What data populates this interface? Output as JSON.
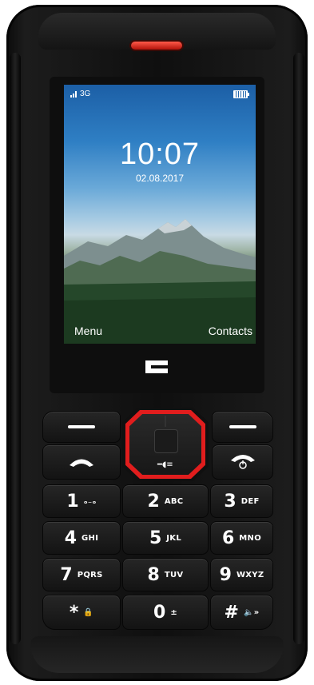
{
  "status_bar": {
    "signal_icon": "signal-bars-icon",
    "network": "3G",
    "battery_icon": "battery-full-icon"
  },
  "home": {
    "time": "10:07",
    "date": "02.08.2017",
    "wallpaper": "mountain-forest-landscape"
  },
  "softkeys": {
    "left": "Menu",
    "right": "Contacts"
  },
  "brand_logo": "crosscall-logo",
  "keypad": {
    "left_softkey_icon": "dash-icon",
    "right_softkey_icon": "dash-icon",
    "call_icon": "phone-call-icon",
    "end_icon": "phone-end-power-icon",
    "nav_center_icon": "torch-icon",
    "keys": [
      {
        "num": "1",
        "letters": "ₒ₋ₒ"
      },
      {
        "num": "2",
        "letters": "ABC"
      },
      {
        "num": "3",
        "letters": "DEF"
      },
      {
        "num": "4",
        "letters": "GHI"
      },
      {
        "num": "5",
        "letters": "JKL"
      },
      {
        "num": "6",
        "letters": "MNO"
      },
      {
        "num": "7",
        "letters": "PQRS"
      },
      {
        "num": "8",
        "letters": "TUV"
      },
      {
        "num": "9",
        "letters": "WXYZ"
      },
      {
        "num": "*",
        "letters": "🔒"
      },
      {
        "num": "0",
        "letters": "±"
      },
      {
        "num": "#",
        "letters": "🔈»"
      }
    ]
  },
  "colors": {
    "accent": "#e11d1d",
    "body": "#141414",
    "earpiece": "#e8392a"
  }
}
